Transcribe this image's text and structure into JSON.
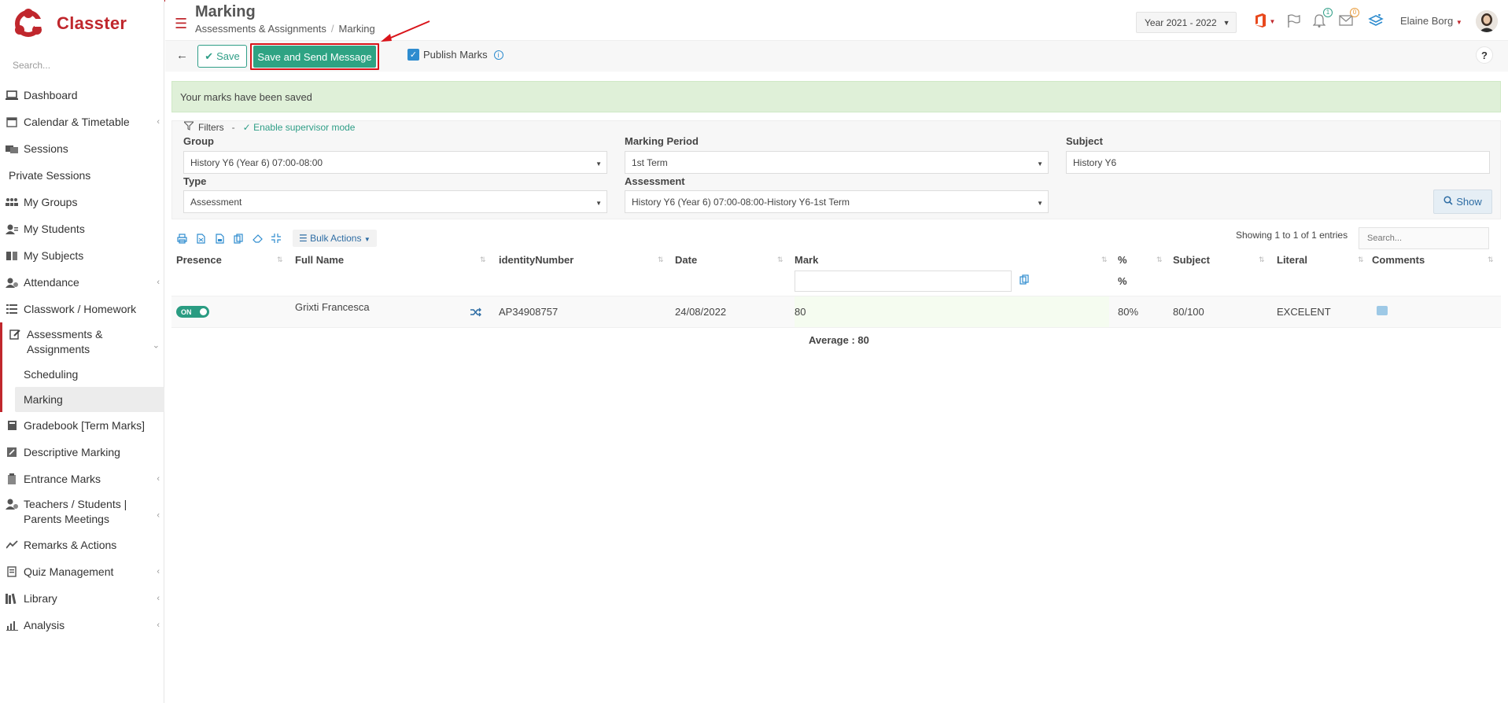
{
  "app": {
    "name": "Classter",
    "brand_color": "#c0272d",
    "accent_color": "#2ea383"
  },
  "sidebar": {
    "search_placeholder": "Search...",
    "items": [
      {
        "label": "Dashboard",
        "icon": "laptop-icon",
        "chevron": false
      },
      {
        "label": "Calendar & Timetable",
        "icon": "calendar-icon",
        "chevron": true
      },
      {
        "label": "Sessions",
        "icon": "sessions-icon",
        "chevron": false
      },
      {
        "label": "Private Sessions",
        "icon": "",
        "chevron": false
      },
      {
        "label": "My Groups",
        "icon": "groups-icon",
        "chevron": false
      },
      {
        "label": "My Students",
        "icon": "students-icon",
        "chevron": false
      },
      {
        "label": "My Subjects",
        "icon": "book-icon",
        "chevron": false
      },
      {
        "label": "Attendance",
        "icon": "attendance-icon",
        "chevron": true
      },
      {
        "label": "Classwork / Homework",
        "icon": "list-icon",
        "chevron": false
      },
      {
        "label": "Assessments & Assignments",
        "icon": "edit-icon",
        "chevron": true,
        "expanded": true
      },
      {
        "label": "Gradebook [Term Marks]",
        "icon": "gradebook-icon",
        "chevron": false
      },
      {
        "label": "Descriptive Marking",
        "icon": "descriptive-icon",
        "chevron": false
      },
      {
        "label": "Entrance Marks",
        "icon": "clipboard-icon",
        "chevron": true
      },
      {
        "label": "Teachers / Students | Parents Meetings",
        "icon": "meeting-icon",
        "chevron": true
      },
      {
        "label": "Remarks & Actions",
        "icon": "remarks-icon",
        "chevron": false
      },
      {
        "label": "Quiz Management",
        "icon": "quiz-icon",
        "chevron": true
      },
      {
        "label": "Library",
        "icon": "library-icon",
        "chevron": true
      },
      {
        "label": "Analysis",
        "icon": "analysis-icon",
        "chevron": true
      }
    ],
    "sub_items": [
      {
        "label": "Scheduling",
        "active": false
      },
      {
        "label": "Marking",
        "active": true
      }
    ]
  },
  "header": {
    "title": "Marking",
    "breadcrumb": [
      "Assessments & Assignments",
      "Marking"
    ],
    "year": "Year 2021 - 2022",
    "notifications_count": "1",
    "messages_count": "0",
    "user_name": "Elaine Borg"
  },
  "toolbar": {
    "save_label": "Save",
    "save_send_label": "Save and Send Message",
    "publish_label": "Publish Marks",
    "help_label": "?"
  },
  "alert": {
    "text": "Your marks have been saved"
  },
  "filters": {
    "title": "Filters",
    "supervisor_link": "Enable supervisor mode",
    "group_label": "Group",
    "group_value": "History Y6 (Year 6) 07:00-08:00",
    "period_label": "Marking Period",
    "period_value": "1st Term",
    "subject_label": "Subject",
    "subject_value": "History Y6",
    "type_label": "Type",
    "type_value": "Assessment",
    "assessment_label": "Assessment",
    "assessment_value": "History Y6 (Year 6) 07:00-08:00-History Y6-1st Term",
    "show_label": "Show"
  },
  "table": {
    "bulk_label": "Bulk Actions",
    "showing": "Showing 1 to 1 of 1 entries",
    "search_placeholder": "Search...",
    "columns": [
      "Presence",
      "Full Name",
      "identityNumber",
      "Date",
      "Mark",
      "%",
      "Subject",
      "Literal",
      "Comments"
    ],
    "pct_sub": "%",
    "rows": [
      {
        "presence": "ON",
        "full_name": "Grixti Francesca",
        "identity": "AP34908757",
        "date": "24/08/2022",
        "mark": "80",
        "percent": "80%",
        "subject": "80/100",
        "literal": "EXCELENT"
      }
    ],
    "average": "Average : 80"
  }
}
